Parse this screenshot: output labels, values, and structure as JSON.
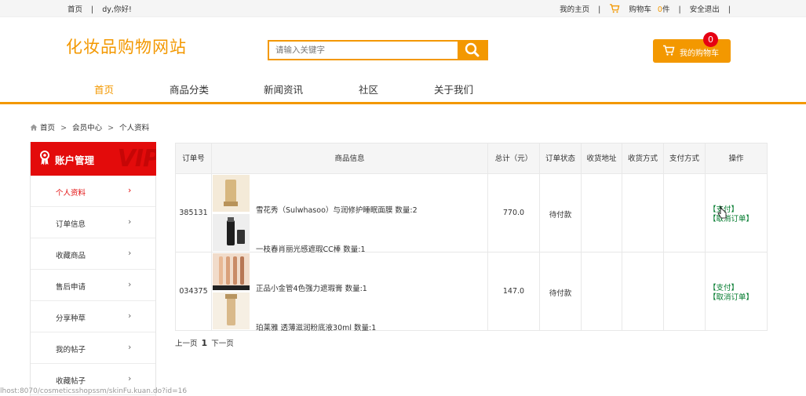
{
  "topbar": {
    "home": "首页",
    "divider": "|",
    "greeting": "dy,你好!",
    "my_home": "我的主页",
    "cart_prefix": "购物车",
    "cart_count": "0",
    "cart_suffix": "件",
    "logout": "安全退出"
  },
  "header": {
    "logo": "化妆品购物网站",
    "search_placeholder": "请输入关键字",
    "cart_button": "我的购物车",
    "cart_badge": "0"
  },
  "nav": {
    "items": [
      "首页",
      "商品分类",
      "新闻资讯",
      "社区",
      "关于我们"
    ]
  },
  "breadcrumb": {
    "items": [
      "首页",
      "会员中心",
      "个人资料"
    ],
    "separator": ">"
  },
  "sidebar": {
    "title": "账户管理",
    "watermark": "VIP",
    "arrow": "›",
    "items": [
      {
        "label": "个人资料"
      },
      {
        "label": "订单信息"
      },
      {
        "label": "收藏商品"
      },
      {
        "label": "售后申请"
      },
      {
        "label": "分享种草"
      },
      {
        "label": "我的帖子"
      },
      {
        "label": "收藏帖子"
      }
    ]
  },
  "table": {
    "headers": {
      "order_no": "订单号",
      "goods": "商品信息",
      "total": "总计（元）",
      "status": "订单状态",
      "address": "收货地址",
      "ship": "收货方式",
      "pay": "支付方式",
      "ops": "操作"
    },
    "rows": [
      {
        "order_no": "385131",
        "goods1": "雪花秀（Sulwhasoo）与润修护睡眠面膜 数量:2",
        "goods2": "一枝春肖丽光感遮瑕CC棒 数量:1",
        "total": "770.0",
        "status": "待付款",
        "op_pay": "【支付】",
        "op_cancel": "【取消订单】"
      },
      {
        "order_no": "034375",
        "goods1": "正品小金管4色强力遮瑕膏 数量:1",
        "goods2": "珀莱雅 透薄滋润粉底液30ml 数量:1",
        "total": "147.0",
        "status": "待付款",
        "op_pay": "【支付】",
        "op_cancel": "【取消订单】"
      }
    ]
  },
  "pager": {
    "prev": "上一页",
    "current": "1",
    "next": "下一页"
  },
  "statusbar": {
    "url": "lhost:8070/cosmeticsshopssm/skinFu.kuan.do?id=16"
  },
  "colors": {
    "accent": "#f39800",
    "sidebar_header": "#e30b0b",
    "op_link": "#007a2c"
  }
}
